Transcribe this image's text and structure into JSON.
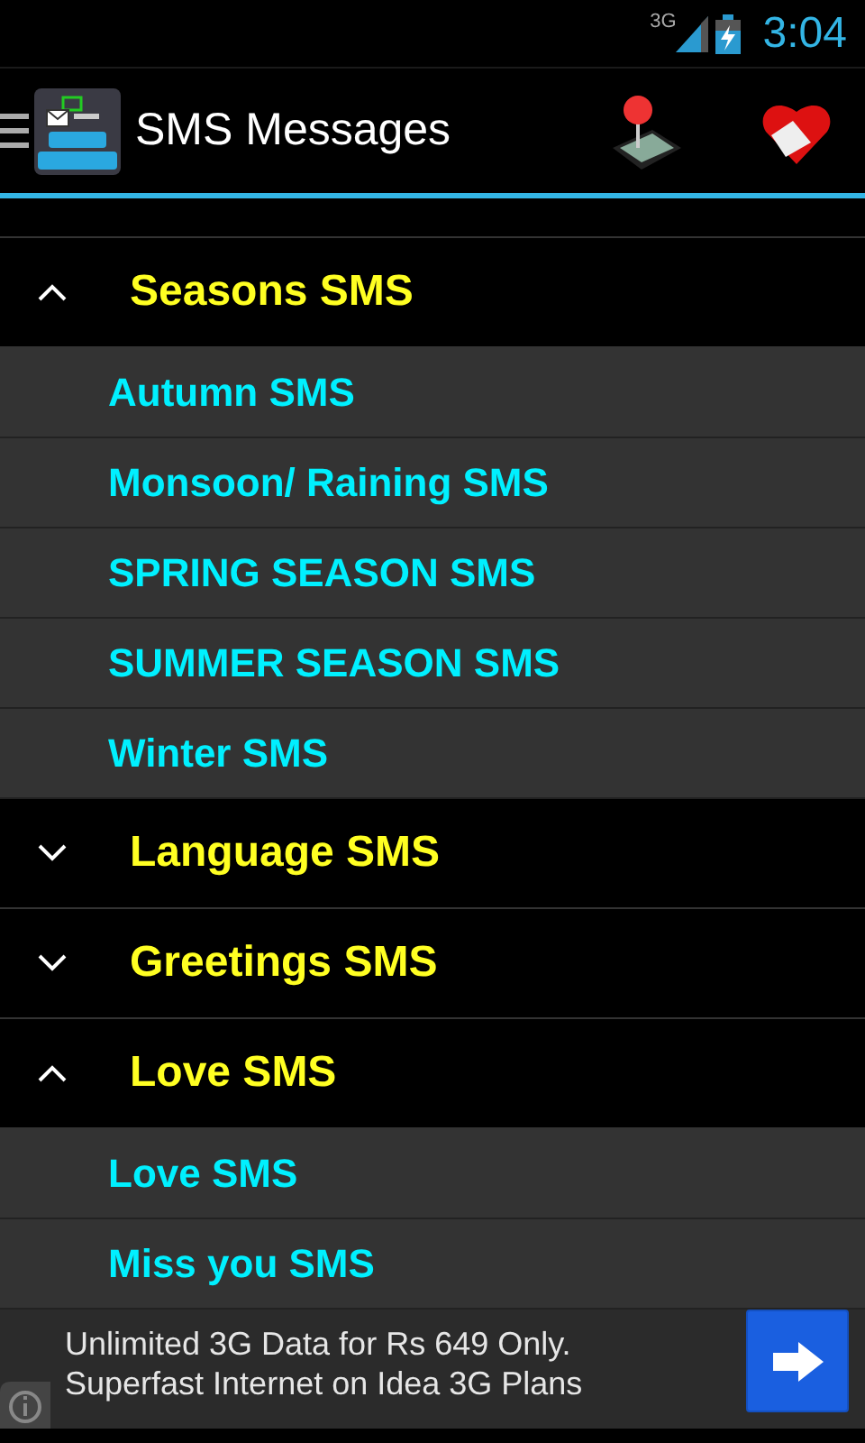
{
  "status_bar": {
    "network": "3G",
    "time": "3:04"
  },
  "action_bar": {
    "title": "SMS Messages"
  },
  "groups": [
    {
      "label": "Seasons SMS",
      "expanded": true,
      "children": [
        {
          "label": "Autumn SMS"
        },
        {
          "label": "Monsoon/ Raining SMS"
        },
        {
          "label": "SPRING SEASON SMS"
        },
        {
          "label": "SUMMER SEASON SMS"
        },
        {
          "label": "Winter SMS"
        }
      ]
    },
    {
      "label": "Language SMS",
      "expanded": false
    },
    {
      "label": "Greetings SMS",
      "expanded": false
    },
    {
      "label": "Love SMS",
      "expanded": true,
      "children": [
        {
          "label": "Love SMS"
        },
        {
          "label": "Miss you SMS"
        }
      ]
    }
  ],
  "ad": {
    "line_1": "Unlimited 3G Data for Rs 649 Only.",
    "line_2": "Superfast Internet on Idea 3G Plans"
  }
}
